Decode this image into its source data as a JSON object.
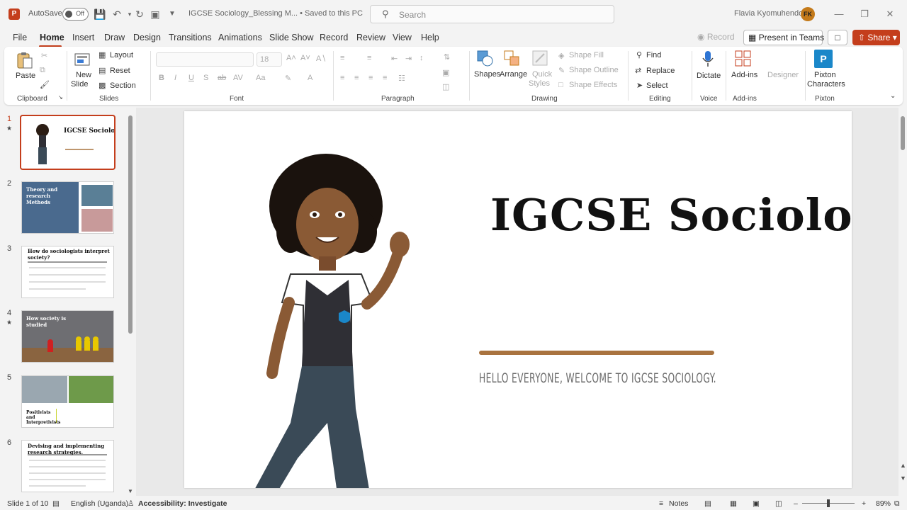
{
  "titlebar": {
    "app_logo": "P",
    "autosave_label": "AutoSave",
    "autosave_state": "Off",
    "filename": "IGCSE Sociology_Blessing M... • Saved to this PC",
    "search_placeholder": "Search",
    "user_name": "Flavia Kyomuhendo",
    "user_initials": "FK"
  },
  "menu": {
    "tabs": [
      "File",
      "Home",
      "Insert",
      "Draw",
      "Design",
      "Transitions",
      "Animations",
      "Slide Show",
      "Record",
      "Review",
      "View",
      "Help"
    ],
    "active": "Home",
    "record_btn": "Record",
    "present_teams": "Present in Teams",
    "share": "Share"
  },
  "ribbon": {
    "clipboard": {
      "paste": "Paste",
      "label": "Clipboard"
    },
    "slides": {
      "new_slide_1": "New",
      "new_slide_2": "Slide",
      "layout": "Layout",
      "reset": "Reset",
      "section": "Section",
      "label": "Slides"
    },
    "font": {
      "size": "18",
      "label": "Font"
    },
    "paragraph": {
      "label": "Paragraph"
    },
    "drawing": {
      "shapes": "Shapes",
      "arrange": "Arrange",
      "quick_styles_1": "Quick",
      "quick_styles_2": "Styles",
      "shape_fill": "Shape Fill",
      "shape_outline": "Shape Outline",
      "shape_effects": "Shape Effects",
      "label": "Drawing"
    },
    "editing": {
      "find": "Find",
      "replace": "Replace",
      "select": "Select",
      "label": "Editing"
    },
    "voice": {
      "dictate": "Dictate",
      "label": "Voice"
    },
    "addins": {
      "addins": "Add-ins",
      "designer": "Designer",
      "label": "Add-ins"
    },
    "pixton": {
      "line1": "Pixton",
      "line2": "Characters",
      "label": "Pixton"
    }
  },
  "thumbnails": [
    {
      "num": "1",
      "star": true,
      "title": "IGCSE Sociology"
    },
    {
      "num": "2",
      "star": false,
      "title": "Theory and research Methods"
    },
    {
      "num": "3",
      "star": false,
      "title": "How do sociologists interpret society?"
    },
    {
      "num": "4",
      "star": true,
      "title": "How society is studied"
    },
    {
      "num": "5",
      "star": false,
      "title": "Positivists and Interpretivists"
    },
    {
      "num": "6",
      "star": false,
      "title": "Devising and implementing research strategies."
    }
  ],
  "slide": {
    "title": "IGCSE Sociology",
    "subtitle": "HELLO EVERYONE, WELCOME TO IGCSE SOCIOLOGY."
  },
  "statusbar": {
    "slide_count": "Slide 1 of 10",
    "language": "English (Uganda)",
    "accessibility": "Accessibility: Investigate",
    "notes": "Notes",
    "zoom": "89%"
  },
  "colors": {
    "accent": "#c43e1c",
    "rule": "#a9733f",
    "pixton": "#1a87c9"
  }
}
